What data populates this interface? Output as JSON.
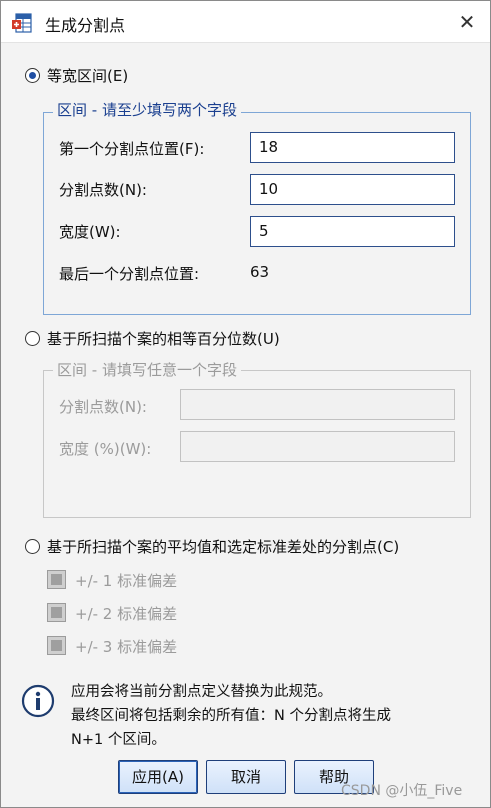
{
  "window": {
    "title": "生成分割点",
    "close_glyph": "✕"
  },
  "equal_width": {
    "radio_label": "等宽区间(E)",
    "group_legend": "区间 - 请至少填写两个字段",
    "first_cut_label": "第一个分割点位置(F):",
    "first_cut_value": "18",
    "num_cuts_label": "分割点数(N):",
    "num_cuts_value": "10",
    "width_label": "宽度(W):",
    "width_value": "5",
    "last_cut_label": "最后一个分割点位置:",
    "last_cut_value": "63"
  },
  "percentiles": {
    "radio_label": "基于所扫描个案的相等百分位数(U)",
    "group_legend": "区间 - 请填写任意一个字段",
    "num_cuts_label": "分割点数(N):",
    "width_label": "宽度 (%)(W):"
  },
  "mean_sd": {
    "radio_label": "基于所扫描个案的平均值和选定标准差处的分割点(C)",
    "options": [
      "+/- 1 标准偏差",
      "+/- 2 标准偏差",
      "+/- 3 标准偏差"
    ]
  },
  "info": {
    "line1": "应用会将当前分割点定义替换为此规范。",
    "line2": "最终区间将包括剩余的所有值：N 个分割点将生成",
    "line3": "N+1 个区间。"
  },
  "buttons": {
    "apply": "应用(A)",
    "cancel": "取消",
    "help": "帮助"
  },
  "watermark": "CSDN @小伍_Five",
  "colors": {
    "accent": "#1f4ea3",
    "group_border": "#7ea6d6",
    "disabled_text": "#9b9b9b"
  }
}
